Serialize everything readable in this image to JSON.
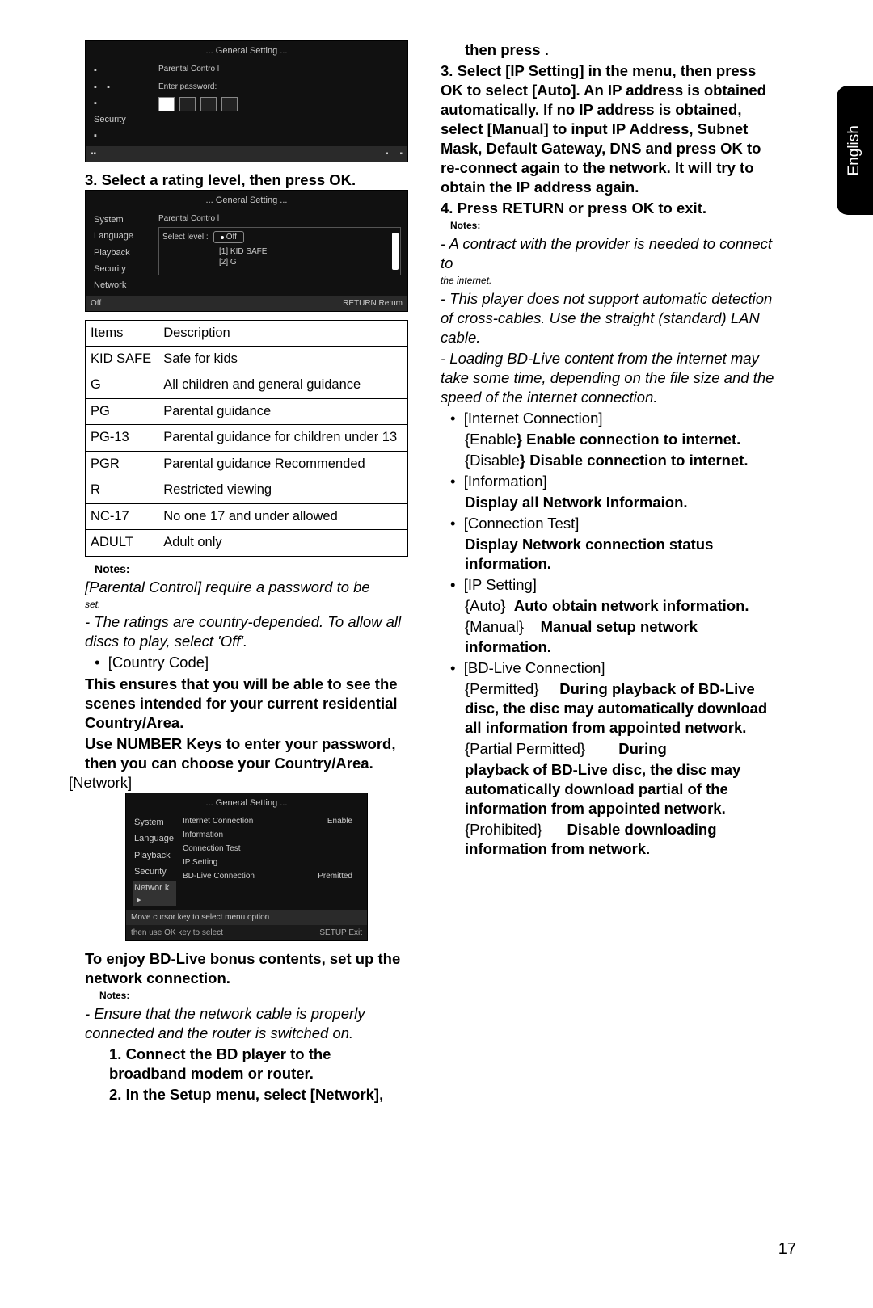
{
  "sidetab": "English",
  "page_number": "17",
  "osd1": {
    "title": "... General Setting ...",
    "menu": [
      "",
      "",
      "",
      "Security",
      ""
    ],
    "panel_title": "Parental Contro l",
    "enter_pw": "Enter password:",
    "footer_left": "",
    "activeIcon": ""
  },
  "left": {
    "step3": "3. Select a rating level, then press OK.",
    "osd2": {
      "title": "... General Setting ...",
      "menu": [
        "System",
        "Language",
        "Playback",
        "Security",
        "Network"
      ],
      "panel_title": "Parental Contro l",
      "select_level": "Select level :",
      "off": "Off",
      "opts": [
        "[1] KID SAFE",
        "[2] G"
      ],
      "footer_status": "Off",
      "footer_action": "RETURN  Retum"
    },
    "table": {
      "h1": "Items",
      "h2": "Description",
      "rows": [
        {
          "a": "KID SAFE",
          "b": "Safe for kids"
        },
        {
          "a": "G",
          "b": "All children and general guidance"
        },
        {
          "a": "PG",
          "b": "Parental guidance"
        },
        {
          "a": "PG-13",
          "b": "Parental guidance for children under 13"
        },
        {
          "a": "PGR",
          "b": "Parental guidance Recommended"
        },
        {
          "a": "R",
          "b": "Restricted viewing"
        },
        {
          "a": "NC-17",
          "b": "No one 17 and under allowed"
        },
        {
          "a": "ADULT",
          "b": "Adult only"
        }
      ]
    },
    "notes_label": "Notes:",
    "pc_note1": "[Parental Control] require a password to be",
    "pc_note1b": "set.",
    "pc_note2": "- The ratings are country-depended. To allow all discs to play, select 'Off'.",
    "country_code": "[Country Code]",
    "cc_b1": "This ensures that you will be able to see the scenes intended for your current residential  Country/Area.",
    "cc_b2": "Use NUMBER Keys to enter your password, then you can choose your Country/Area.",
    "network_label": "[Network]",
    "osd3": {
      "title": "... General Setting ...",
      "menu": [
        "System",
        "Language",
        "Playback",
        "Security",
        "Networ k"
      ],
      "rows": [
        {
          "a": "Internet Connection",
          "b": "Enable"
        },
        {
          "a": "Information",
          "b": ""
        },
        {
          "a": "Connection Test",
          "b": ""
        },
        {
          "a": "IP Setting",
          "b": ""
        },
        {
          "a": "BD-Live Connection",
          "b": "Premitted"
        }
      ],
      "hint1": "Move cursor key to select menu option",
      "hint2": "then use  OK  key to select",
      "footer_action": "SETUP  Exit"
    },
    "bd_intro": "To enjoy BD-Live bonus contents, set up the network connection.",
    "notes2": "Notes:",
    "bd_note1": "- Ensure that the network cable is properly connected and the router is switched on.",
    "step1": "1. Connect the BD player to the broadband modem or router.",
    "step2": "2. In the Setup menu, select [Network],"
  },
  "right": {
    "cont": "then press .",
    "step3": "3. Select [IP Setting] in the menu, then press OK to select [Auto]. An IP address is obtained automatically. If no IP address is obtained, select [Manual] to input IP Address, Subnet Mask, Default Gateway, DNS and press OK to re-connect again to the network. It will try to obtain the IP address again.",
    "step4": "4. Press RETURN or press OK to exit.",
    "notes": "Notes:",
    "n1": "- A contract with the provider is needed to connect to",
    "n1b": "the internet.",
    "n2": "- This player does not support automatic detection of cross-cables. Use the straight (standard) LAN cable.",
    "n3": "- Loading BD-Live content from the internet may take some time, depending on the file size and the speed of the internet connection.",
    "ic": "[Internet Connection]",
    "ic_en_l": "{Enable",
    "ic_en_b": "}  Enable connection to internet.",
    "ic_di_l": "{Disable",
    "ic_di_b": "}  Disable connection to internet.",
    "info": "[Information]",
    "info_b": "Display all Network Informaion.",
    "ct": "[Connection Test]",
    "ct_b": "Display Network connection status information.",
    "ip": "[IP Setting]",
    "ip_auto_l": "{Auto}",
    "ip_auto_b": "Auto obtain network information.",
    "ip_man_l": "{Manual}",
    "ip_man_b": "Manual setup network information.",
    "bdc": "[BD-Live Connection]",
    "bdc_p_l": "{Permitted}",
    "bdc_p_b": "During playback of BD-Live disc, the disc may automatically download all information from appointed network.",
    "bdc_pp_l": "{Partial Permitted}",
    "bdc_pp_b1": "During",
    "bdc_pp_b": "playback of BD-Live disc, the disc may automatically download partial of the information from appointed network.",
    "bdc_pr_l": "{Prohibited}",
    "bdc_pr_b": "Disable downloading information from network."
  }
}
